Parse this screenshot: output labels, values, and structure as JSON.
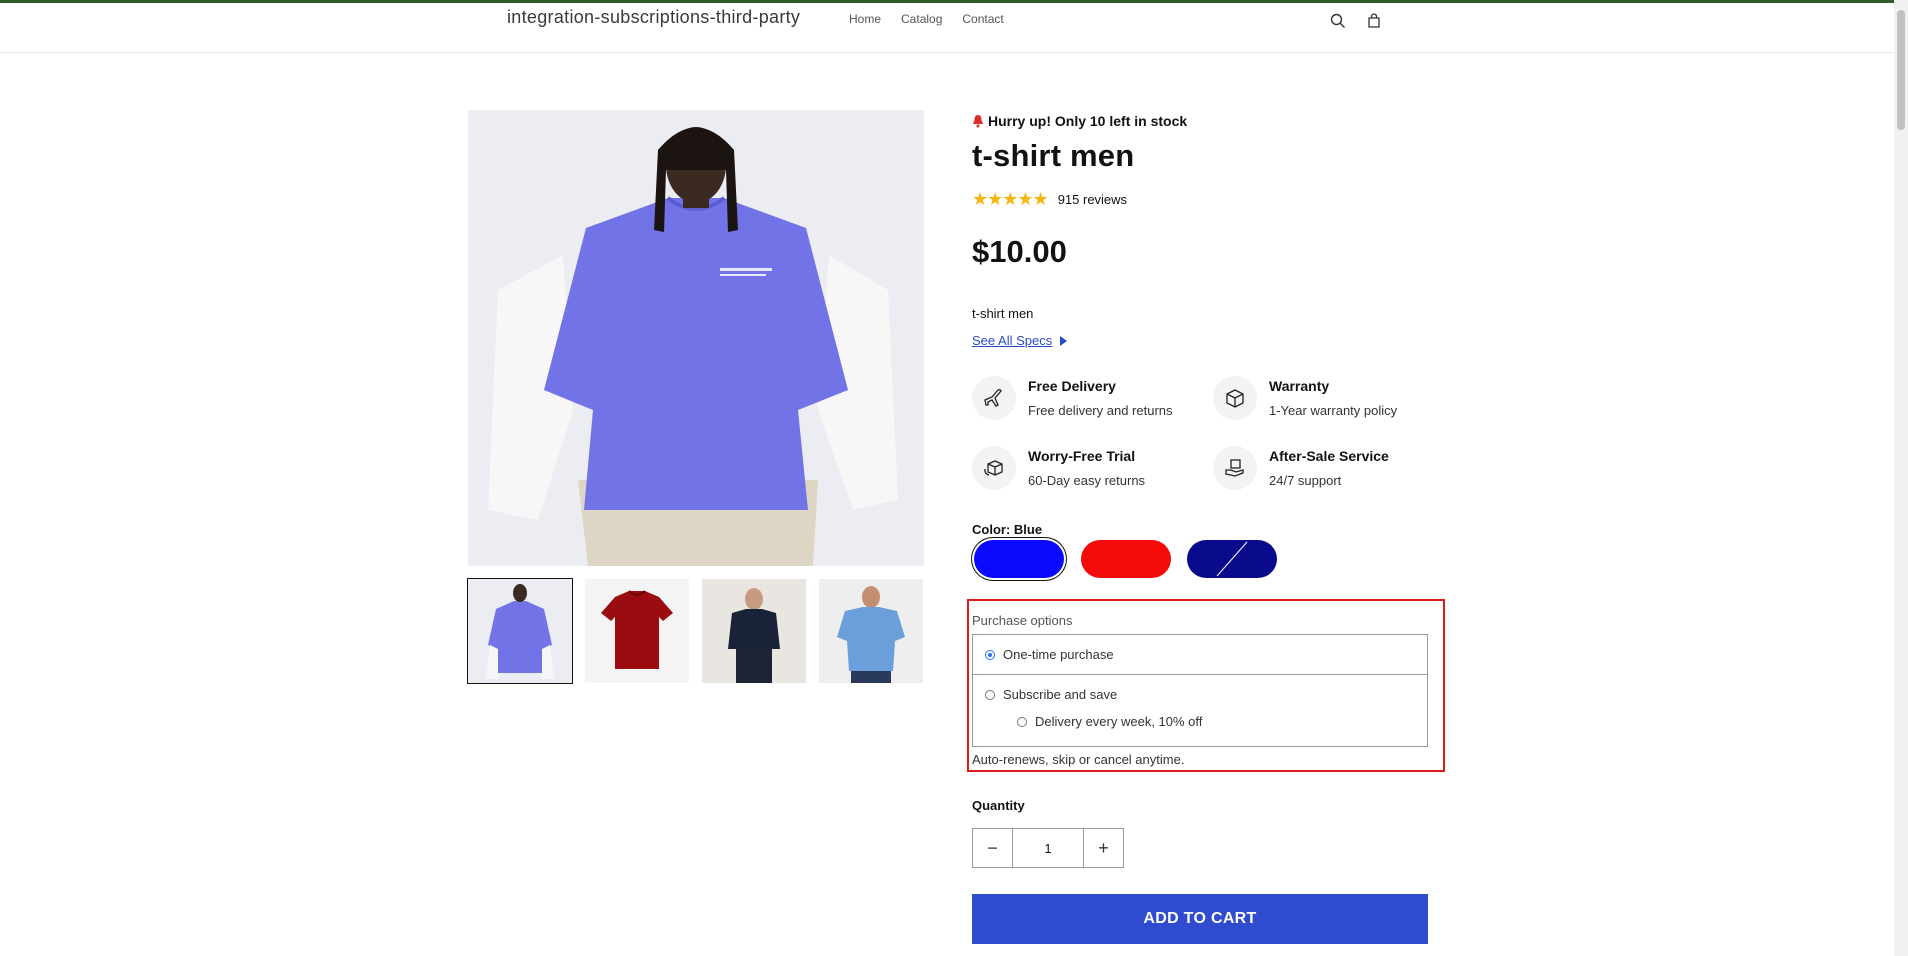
{
  "header": {
    "store_name": "integration-subscriptions-third-party",
    "nav": [
      "Home",
      "Catalog",
      "Contact"
    ],
    "icons": [
      "search-icon",
      "cart-icon"
    ]
  },
  "product": {
    "stock_alert": "Hurry up! Only 10 left in stock",
    "title": "t-shirt men",
    "rating": {
      "stars": 5,
      "reviews": "915 reviews"
    },
    "price": "$10.00",
    "description": "t-shirt men",
    "specs_link": "See All Specs",
    "gallery": {
      "images": 5,
      "selected_thumbnail": 1
    }
  },
  "features": [
    {
      "title": "Free Delivery",
      "subtitle": "Free delivery and returns",
      "icon": "plane-icon"
    },
    {
      "title": "Warranty",
      "subtitle": "1-Year warranty policy",
      "icon": "box-icon"
    },
    {
      "title": "Worry-Free Trial",
      "subtitle": "60-Day easy returns",
      "icon": "return-box-icon"
    },
    {
      "title": "After-Sale Service",
      "subtitle": "24/7 support",
      "icon": "support-hand-icon"
    }
  ],
  "color": {
    "label": "Color: Blue",
    "swatches": [
      {
        "name": "Blue",
        "hex": "#0a0aff",
        "selected": true
      },
      {
        "name": "Red",
        "hex": "#f50a0a",
        "selected": false
      },
      {
        "name": "Navy",
        "hex": "#0a0a8c",
        "selected": false,
        "unavailable": true
      }
    ]
  },
  "purchase_options": {
    "label": "Purchase options",
    "one_time": "One-time purchase",
    "subscribe": "Subscribe and save",
    "delivery_option": "Delivery every week, 10% off",
    "selected": "One-time purchase",
    "note": "Auto-renews, skip or cancel anytime.",
    "highlight_color": "#e01b1b"
  },
  "quantity": {
    "label": "Quantity",
    "value": "1",
    "minus": "−",
    "plus": "+"
  },
  "add_to_cart": "ADD TO CART",
  "colors": {
    "accent": "#2f4bd0",
    "star": "#f5b50a",
    "top_bar": "#2e5e2e"
  }
}
